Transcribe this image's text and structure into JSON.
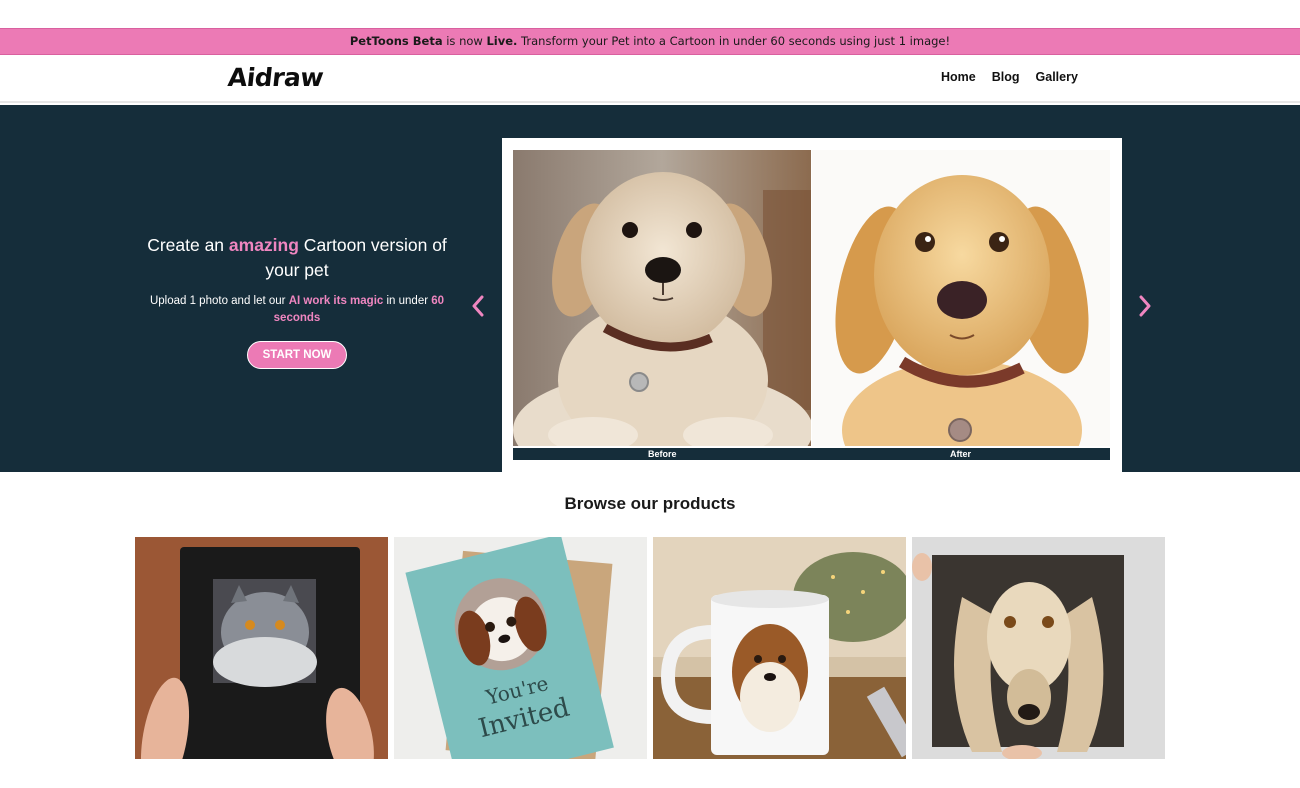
{
  "announcement": {
    "brand": "PetToons Beta",
    "mid": " is now ",
    "status": "Live.",
    "rest": " Transform your Pet into a Cartoon in under 60 seconds using just 1 image!"
  },
  "header": {
    "logo": "Aidraw",
    "nav": [
      {
        "label": "Home"
      },
      {
        "label": "Blog"
      },
      {
        "label": "Gallery"
      }
    ]
  },
  "hero": {
    "title_pre": "Create an ",
    "title_highlight": "amazing",
    "title_post": " Cartoon version of your pet",
    "sub_pre": "Upload 1 photo and let our ",
    "sub_highlight1": "AI work its magic",
    "sub_mid": " in under ",
    "sub_highlight2": "60 seconds",
    "cta_label": "START NOW",
    "slide": {
      "before_label": "Before",
      "after_label": "After"
    },
    "colors": {
      "accent": "#ec7ab5",
      "background": "#152d3a"
    }
  },
  "products": {
    "title": "Browse our products",
    "items": [
      {
        "name": "notebook-cat"
      },
      {
        "name": "invitation-card-dog",
        "card_text_1": "You're",
        "card_text_2": "Invited"
      },
      {
        "name": "mug-collie"
      },
      {
        "name": "canvas-afghan-hound"
      }
    ]
  }
}
